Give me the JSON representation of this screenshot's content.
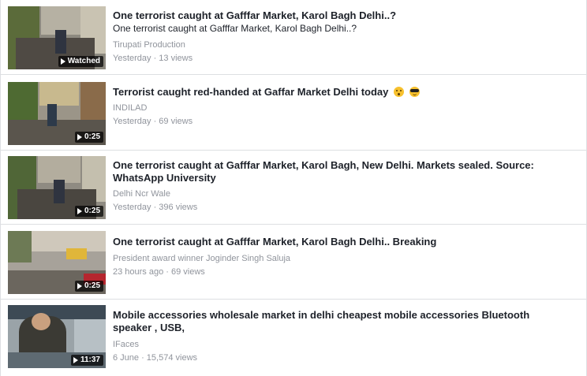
{
  "videos": [
    {
      "title": "One terrorist caught at Gafffar Market, Karol Bagh Delhi..?",
      "subtitle": "One terrorist caught at Gafffar Market, Karol Bagh Delhi..?",
      "channel": "Tirupati Production",
      "meta": "Yesterday · 13 views",
      "badge": "Watched"
    },
    {
      "title": "Terrorist caught red-handed at Gaffar Market Delhi today",
      "emojis": [
        "hushed-face-emoji",
        "smiling-face-with-sunglasses-emoji"
      ],
      "channel": "INDILAD",
      "meta": "Yesterday · 69 views",
      "badge": "0:25"
    },
    {
      "title": "One terrorist caught at Gafffar Market, Karol Bagh, New Delhi. Markets sealed. Source: WhatsApp University",
      "channel": "Delhi Ncr Wale",
      "meta": "Yesterday · 396 views",
      "badge": "0:25"
    },
    {
      "title": "One terrorist caught at Gafffar Market, Karol Bagh Delhi.. Breaking",
      "channel": "President award winner Joginder Singh Saluja",
      "meta": "23 hours ago · 69 views",
      "badge": "0:25"
    },
    {
      "title": "Mobile accessories wholesale market in delhi cheapest mobile accessories Bluetooth speaker , USB,",
      "channel": "IFaces",
      "meta": "6 June · 15,574 views",
      "badge": "11:37"
    }
  ],
  "icons": {
    "play": "play-icon"
  },
  "colors": {
    "title": "#1d2129",
    "meta": "#90949c",
    "divider": "#dddfe2",
    "badge_bg": "rgba(0,0,0,0.72)"
  }
}
